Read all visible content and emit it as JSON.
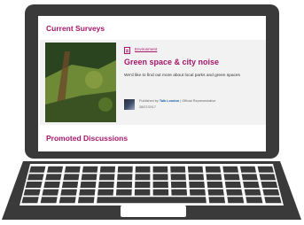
{
  "sections": {
    "current_surveys": "Current Surveys",
    "promoted_discussions": "Promoted Discussions"
  },
  "survey_card": {
    "category": "Environment",
    "title": "Green space & city noise",
    "description": "We'd like to find out more about local parks and green spaces",
    "published_prefix": "Published by",
    "author": "Talk London",
    "author_role": "| Official Representative",
    "date": "28/07/2017"
  },
  "colors": {
    "accent": "#a5176b",
    "link": "#1a5ea8",
    "laptop_body": "#3a3a3a"
  },
  "icons": [
    "category-icon",
    "keyboard",
    "trackpad"
  ]
}
